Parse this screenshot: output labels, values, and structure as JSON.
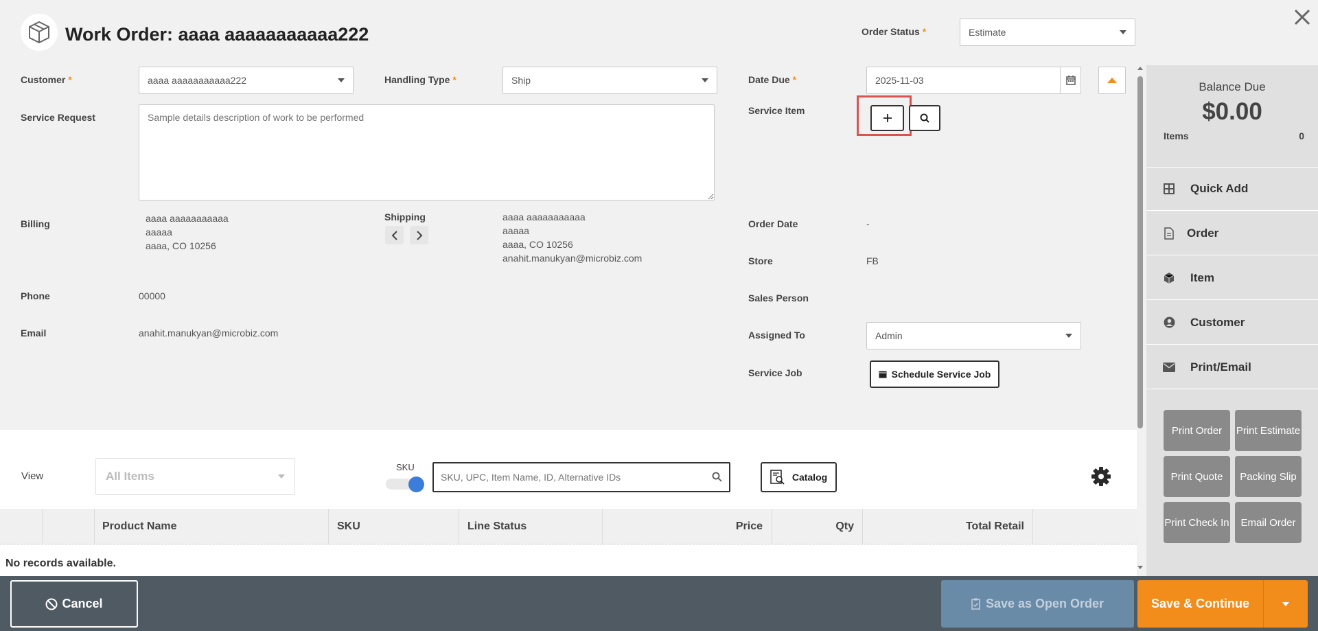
{
  "header": {
    "title": "Work Order: aaaa aaaaaaaaaaa222",
    "order_status_label": "Order Status",
    "order_status_value": "Estimate"
  },
  "form": {
    "customer_label": "Customer",
    "customer_value": "aaaa aaaaaaaaaaa222",
    "handling_label": "Handling Type",
    "handling_value": "Ship",
    "date_due_label": "Date Due",
    "date_due_value": "2025-11-03",
    "service_request_label": "Service Request",
    "service_request_placeholder": "Sample details description of work to be performed",
    "service_item_label": "Service Item",
    "billing_label": "Billing",
    "billing_lines": [
      "aaaa aaaaaaaaaaa",
      "aaaaa",
      "aaaa, CO 10256"
    ],
    "shipping_label": "Shipping",
    "shipping_lines": [
      "aaaa aaaaaaaaaaa",
      "aaaaa",
      "aaaa, CO 10256",
      "anahit.manukyan@microbiz.com"
    ],
    "order_date_label": "Order Date",
    "order_date_value": "-",
    "store_label": "Store",
    "store_value": "FB",
    "sales_person_label": "Sales Person",
    "phone_label": "Phone",
    "phone_value": "00000",
    "email_label": "Email",
    "email_value": "anahit.manukyan@microbiz.com",
    "assigned_label": "Assigned To",
    "assigned_value": "Admin",
    "service_job_label": "Service Job",
    "schedule_label": "Schedule Service Job"
  },
  "sidebar": {
    "balance_label": "Balance Due",
    "balance_value": "$0.00",
    "items_label": "Items",
    "items_value": "0",
    "menu": [
      {
        "label": "Quick Add",
        "icon": "grid-icon"
      },
      {
        "label": "Order",
        "icon": "document-icon"
      },
      {
        "label": "Item",
        "icon": "box-icon"
      },
      {
        "label": "Customer",
        "icon": "user-circle-icon"
      },
      {
        "label": "Print/Email",
        "icon": "envelope-icon"
      }
    ],
    "buttons": [
      "Print Order",
      "Print Estimate",
      "Print Quote",
      "Packing Slip",
      "Print Check In",
      "Email Order"
    ]
  },
  "items": {
    "view_label": "View",
    "view_value": "All Items",
    "sku_toggle_label": "SKU",
    "search_placeholder": "SKU, UPC, Item Name, ID, Alternative IDs",
    "catalog_label": "Catalog",
    "columns": [
      "Product Name",
      "SKU",
      "Line Status",
      "Price",
      "Qty",
      "Total Retail"
    ],
    "empty_text": "No records available."
  },
  "footer": {
    "cancel_label": "Cancel",
    "save_open_label": "Save as Open Order",
    "save_continue_label": "Save & Continue"
  },
  "colors": {
    "accent": "#f28c1a",
    "footer_bg": "#505a63",
    "save_open_bg": "#6a8ba8",
    "highlight": "#d9534f",
    "toggle": "#3b7dd8"
  }
}
